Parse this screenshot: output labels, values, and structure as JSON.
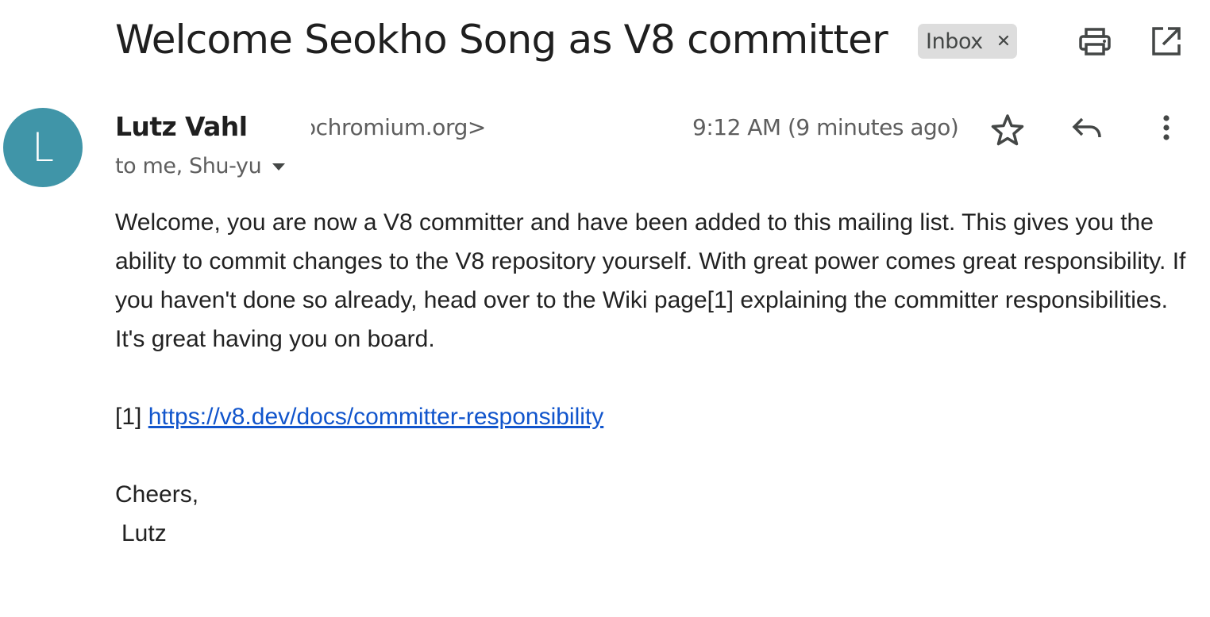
{
  "email": {
    "subject": "Welcome Seokho Song as V8 committer",
    "label": "Inbox",
    "sender": {
      "avatar_initial": "L",
      "name": "Lutz Vahl",
      "email_visible": "ɔchromium.org>"
    },
    "timestamp": "9:12 AM (9 minutes ago)",
    "recipients": "to me, Shu-yu",
    "body": {
      "paragraph": "Welcome, you are now a V8 committer and have been added to this mailing list. This gives you the ability to commit changes to the V8 repository yourself. With great power comes great responsibility. If you haven't done so already, head over to the Wiki page[1] explaining the committer responsibilities. It's great having you on board.",
      "ref_prefix": "[1]",
      "ref_link": "https://v8.dev/docs/committer-responsibility",
      "closing": "Cheers,",
      "signature": "Lutz"
    }
  },
  "icons": {
    "label_remove": "close-icon",
    "print": "print-icon",
    "open_new_window": "open-in-new-icon",
    "star": "star-icon",
    "reply": "reply-icon",
    "more": "more-vert-icon",
    "recipients_caret": "caret-down-icon"
  },
  "colors": {
    "avatar_bg": "#4095a8",
    "link": "#1155cc",
    "chip_bg": "#dddddd",
    "secondary_text": "#5e5e5e"
  }
}
